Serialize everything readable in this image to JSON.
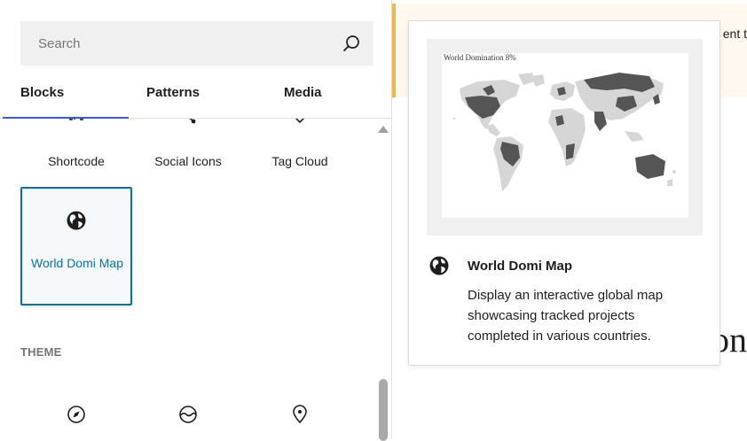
{
  "search": {
    "placeholder": "Search"
  },
  "tabs": [
    {
      "label": "Blocks",
      "active": true
    },
    {
      "label": "Patterns",
      "active": false
    },
    {
      "label": "Media",
      "active": false
    }
  ],
  "blocks": {
    "shortcode": {
      "label": "Shortcode",
      "icon": "shortcode-icon"
    },
    "social_icons": {
      "label": "Social Icons",
      "icon": "share-icon"
    },
    "tag_cloud": {
      "label": "Tag Cloud",
      "icon": "tag-icon"
    },
    "world_domi_map": {
      "label": "World Domi Map",
      "icon": "globe-icon",
      "selected": true
    }
  },
  "theme": {
    "heading": "THEME",
    "blocks": [
      {
        "icon": "compass-icon"
      },
      {
        "icon": "site-logo-icon"
      },
      {
        "icon": "map-marker-icon"
      }
    ]
  },
  "editor": {
    "notice_text": "ent t",
    "heading_fragment": "on"
  },
  "preview": {
    "map_title": "World Domination 8%",
    "title": "World Domi Map",
    "description": "Display an interactive global map showcasing tracked projects completed in various countries."
  },
  "colors": {
    "accent": "#0073aa",
    "tab_indicator": "#3858e9",
    "notice_border": "#f0b849",
    "map_highlight": "#555555",
    "map_base": "#d6d6d6"
  }
}
